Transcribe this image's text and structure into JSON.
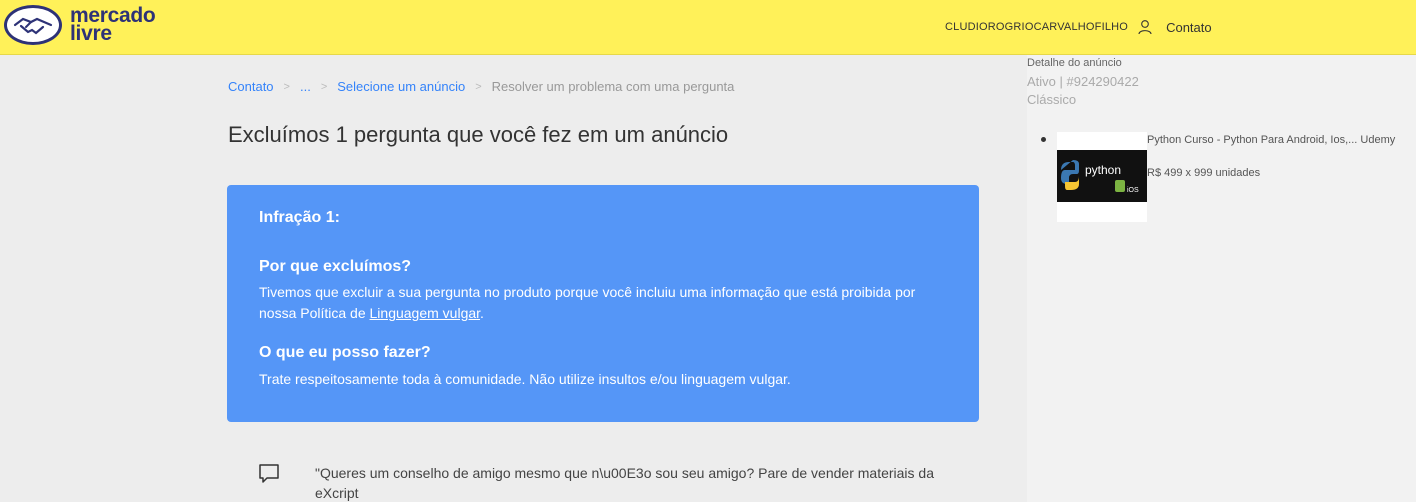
{
  "header": {
    "logo_line1": "mercado",
    "logo_line2": "livre",
    "user_name": "CLUDIOROGRIOCARVALHOFILHO",
    "contact_label": "Contato"
  },
  "breadcrumb": {
    "items": [
      "Contato",
      "...",
      "Selecione um anúncio"
    ],
    "current": "Resolver um problema com uma pergunta",
    "separator": ">"
  },
  "main": {
    "title": "Excluímos 1 pergunta que você fez em um anúncio",
    "card": {
      "infraction_title": "Infração 1:",
      "why_title": "Por que excluímos?",
      "why_text_before": "Tivemos que excluir a sua pergunta no produto porque você  incluiu uma informação que está proibida por nossa Política de ",
      "why_link": "Linguagem vulgar",
      "why_text_after": ".",
      "what_title": "O que eu posso fazer?",
      "what_text": "Trate respeitosamente toda à comunidade.  Não utilize insultos e/ou linguagem vulgar."
    },
    "question_text": "\"Queres um conselho de amigo mesmo que n\\u00E3o sou seu amigo? Pare de vender materiais da eXcript"
  },
  "sidebar": {
    "title": "Detalhe do anúncio",
    "status_id": "Ativo | #924290422",
    "listing_type": "Clássico",
    "product": {
      "title": "Python Curso - Python Para Android, Ios,... Udemy",
      "price": "R$ 499 x 999 unidades",
      "thumb_text": "python",
      "thumb_subtext": "iOS"
    }
  },
  "colors": {
    "header_bg": "#fff159",
    "brand_navy": "#2d3277",
    "link_blue": "#3483fa",
    "card_blue": "#5596f7"
  }
}
